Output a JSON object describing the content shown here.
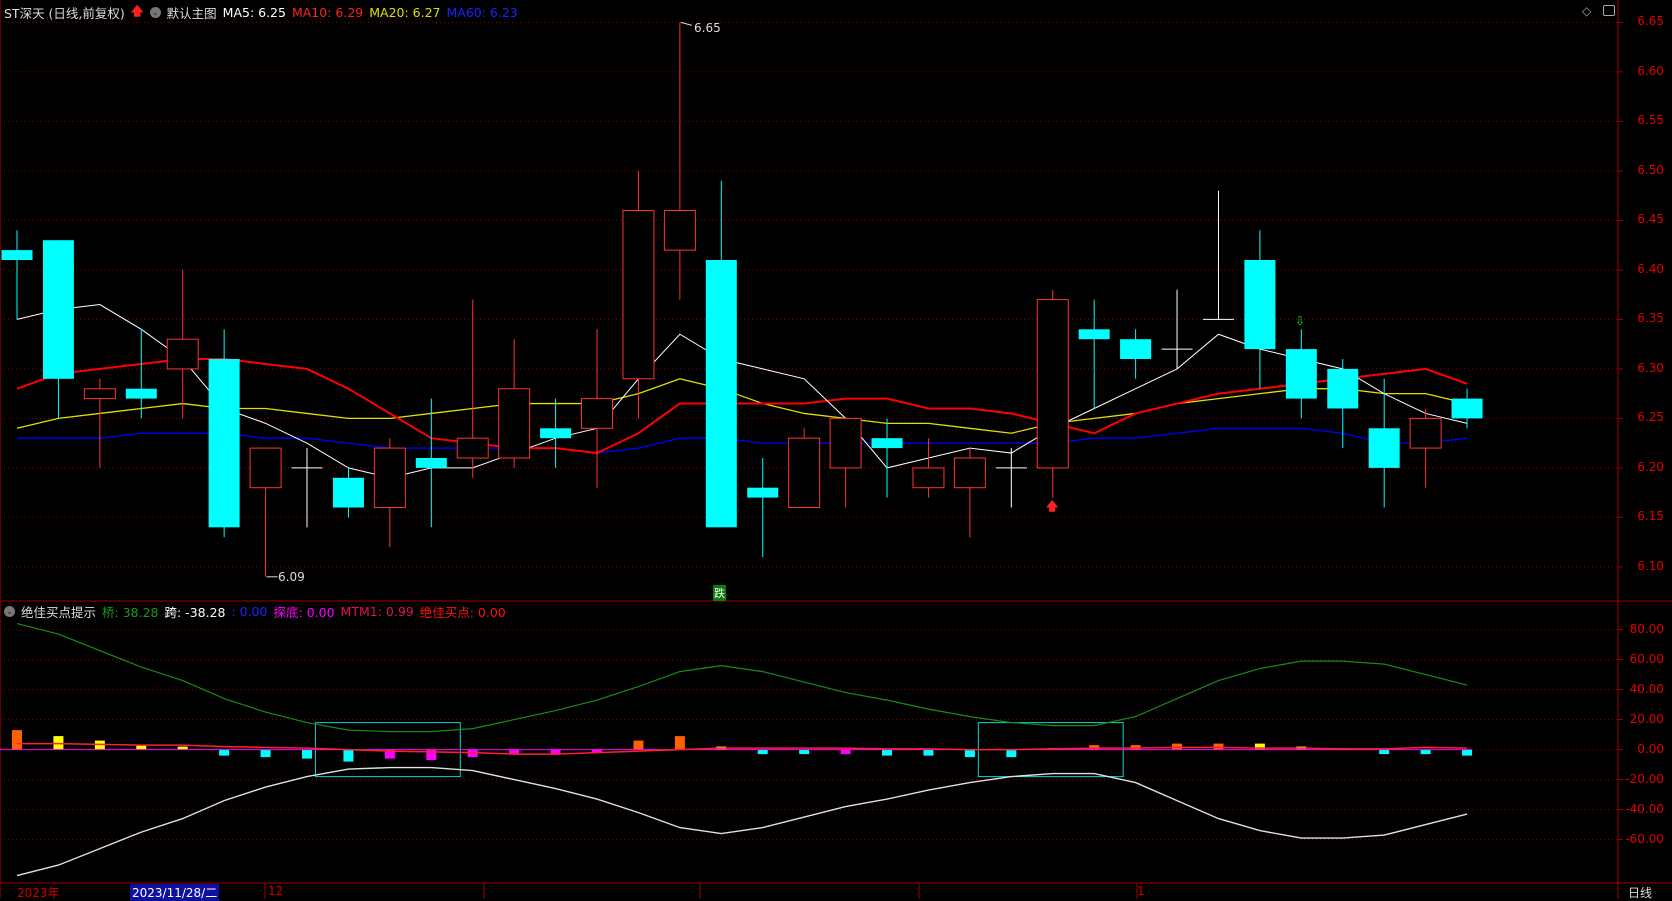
{
  "header": {
    "title": "ST深天 (日线,前复权)",
    "template": "默认主图",
    "ma5": "MA5: 6.25",
    "ma10": "MA10: 6.29",
    "ma20": "MA20: 6.27",
    "ma60": "MA60: 6.23"
  },
  "indicator_header": {
    "name": "绝佳买点提示",
    "qiao": "桥: 38.28",
    "kua": "跨: -38.28",
    "blank": ": 0.00",
    "tandi": "探底: 0.00",
    "mtm1": "MTM1: 0.99",
    "buy": "绝佳买点: 0.00"
  },
  "colors": {
    "up": "#ff3232",
    "down": "#00ffff",
    "ma5": "#ffffff",
    "ma10": "#ff0000",
    "ma20": "#e0e000",
    "ma60": "#0000ff",
    "grid": "#8b0000"
  },
  "price_axis": [
    "6.65",
    "6.60",
    "6.55",
    "6.50",
    "6.45",
    "6.40",
    "6.35",
    "6.30",
    "6.25",
    "6.20",
    "6.15",
    "6.10"
  ],
  "indicator_axis": [
    "80.00",
    "60.00",
    "40.00",
    "20.00",
    "0.00",
    "-20.00",
    "-40.00",
    "-60.00"
  ],
  "annotations": {
    "high": "6.65",
    "low": "6.09",
    "signal": "跌"
  },
  "x_axis": {
    "year": "2023年",
    "cursor_date": "2023/11/28/二",
    "dec": "12",
    "jan": "1",
    "period": "日线"
  },
  "chart_data": {
    "type": "candlestick",
    "ylim": [
      6.08,
      6.66
    ],
    "ohlc": [
      [
        6.42,
        6.44,
        6.35,
        6.41
      ],
      [
        6.43,
        6.43,
        6.25,
        6.29
      ],
      [
        6.27,
        6.29,
        6.2,
        6.28
      ],
      [
        6.28,
        6.34,
        6.25,
        6.27
      ],
      [
        6.3,
        6.4,
        6.25,
        6.33
      ],
      [
        6.31,
        6.34,
        6.13,
        6.14
      ],
      [
        6.18,
        6.22,
        6.09,
        6.22
      ],
      [
        6.2,
        6.22,
        6.14,
        6.2
      ],
      [
        6.19,
        6.2,
        6.15,
        6.16
      ],
      [
        6.16,
        6.23,
        6.12,
        6.22
      ],
      [
        6.21,
        6.27,
        6.14,
        6.2
      ],
      [
        6.21,
        6.37,
        6.19,
        6.23
      ],
      [
        6.21,
        6.33,
        6.2,
        6.28
      ],
      [
        6.24,
        6.27,
        6.2,
        6.23
      ],
      [
        6.24,
        6.34,
        6.18,
        6.27
      ],
      [
        6.29,
        6.5,
        6.25,
        6.46
      ],
      [
        6.42,
        6.65,
        6.37,
        6.46
      ],
      [
        6.41,
        6.49,
        6.14,
        6.14
      ],
      [
        6.18,
        6.21,
        6.11,
        6.17
      ],
      [
        6.16,
        6.24,
        6.16,
        6.23
      ],
      [
        6.2,
        6.25,
        6.16,
        6.25
      ],
      [
        6.23,
        6.25,
        6.17,
        6.22
      ],
      [
        6.18,
        6.23,
        6.17,
        6.2
      ],
      [
        6.18,
        6.22,
        6.13,
        6.21
      ],
      [
        6.2,
        6.22,
        6.16,
        6.2
      ],
      [
        6.2,
        6.38,
        6.17,
        6.37
      ],
      [
        6.34,
        6.37,
        6.26,
        6.33
      ],
      [
        6.33,
        6.34,
        6.29,
        6.31
      ],
      [
        6.32,
        6.38,
        6.3,
        6.32
      ],
      [
        6.35,
        6.48,
        6.35,
        6.35
      ],
      [
        6.41,
        6.44,
        6.28,
        6.32
      ],
      [
        6.32,
        6.34,
        6.25,
        6.27
      ],
      [
        6.3,
        6.31,
        6.22,
        6.26
      ],
      [
        6.24,
        6.29,
        6.16,
        6.2
      ],
      [
        6.22,
        6.26,
        6.18,
        6.25
      ],
      [
        6.27,
        6.28,
        6.24,
        6.25
      ]
    ],
    "ma5": [
      6.35,
      6.36,
      6.365,
      6.34,
      6.31,
      6.26,
      6.245,
      6.225,
      6.2,
      6.19,
      6.2,
      6.2,
      6.215,
      6.23,
      6.24,
      6.29,
      6.335,
      6.31,
      6.3,
      6.29,
      6.25,
      6.2,
      6.21,
      6.22,
      6.215,
      6.24,
      6.26,
      6.28,
      6.3,
      6.335,
      6.32,
      6.31,
      6.3,
      6.275,
      6.255,
      6.245
    ],
    "ma10": [
      6.28,
      6.295,
      6.3,
      6.305,
      6.31,
      6.31,
      6.305,
      6.3,
      6.28,
      6.255,
      6.23,
      6.225,
      6.22,
      6.22,
      6.215,
      6.235,
      6.265,
      6.265,
      6.265,
      6.265,
      6.27,
      6.27,
      6.26,
      6.26,
      6.255,
      6.245,
      6.235,
      6.255,
      6.265,
      6.275,
      6.28,
      6.285,
      6.29,
      6.295,
      6.3,
      6.285
    ],
    "ma20": [
      6.24,
      6.25,
      6.255,
      6.26,
      6.265,
      6.26,
      6.26,
      6.255,
      6.25,
      6.25,
      6.255,
      6.26,
      6.265,
      6.265,
      6.265,
      6.275,
      6.29,
      6.28,
      6.265,
      6.255,
      6.25,
      6.245,
      6.245,
      6.24,
      6.235,
      6.245,
      6.25,
      6.255,
      6.265,
      6.27,
      6.275,
      6.28,
      6.28,
      6.275,
      6.275,
      6.265
    ],
    "ma60": [
      6.23,
      6.23,
      6.23,
      6.235,
      6.235,
      6.235,
      6.23,
      6.23,
      6.225,
      6.22,
      6.22,
      6.22,
      6.22,
      6.22,
      6.215,
      6.22,
      6.23,
      6.23,
      6.225,
      6.225,
      6.225,
      6.225,
      6.225,
      6.225,
      6.225,
      6.225,
      6.23,
      6.23,
      6.235,
      6.24,
      6.24,
      6.24,
      6.235,
      6.225,
      6.225,
      6.23
    ],
    "indicator": {
      "ylim": [
        -70,
        90
      ],
      "qiao": [
        84,
        77,
        66,
        55,
        46,
        34,
        25,
        18,
        13,
        12,
        12,
        14,
        20,
        26,
        33,
        42,
        52,
        56,
        52,
        45,
        38,
        33,
        27,
        22,
        18,
        16,
        16,
        22,
        34,
        46,
        54,
        59,
        59,
        57,
        50,
        43,
        38.28
      ],
      "bars": [
        13,
        9,
        6,
        3,
        2,
        -4,
        -5,
        -6,
        -8,
        -6,
        -7,
        -5,
        -3,
        -3,
        -2,
        6,
        9,
        2,
        -3,
        -3,
        -3,
        -4,
        -4,
        -5,
        -5,
        1,
        3,
        3,
        4,
        4,
        4,
        2,
        1,
        -3,
        -3,
        -4
      ],
      "bar_colors": [
        "#ff6000",
        "#ffff00",
        "#ffff00",
        "#ffff00",
        "#ffff00",
        "#00ffff",
        "#00ffff",
        "#00ffff",
        "#00ffff",
        "#ff00ff",
        "#ff00ff",
        "#ff00ff",
        "#ff00ff",
        "#ff00ff",
        "#ff00ff",
        "#ff6000",
        "#ff6000",
        "#ffff00",
        "#00ffff",
        "#00ffff",
        "#ff00ff",
        "#00ffff",
        "#00ffff",
        "#00ffff",
        "#00ffff",
        "#ff6000",
        "#ff6000",
        "#ff6000",
        "#ff6000",
        "#ff6000",
        "#ffff00",
        "#ffff00",
        "#ff3030",
        "#00ffff",
        "#00ffff",
        "#00ffff"
      ],
      "mtm_line": [
        4,
        4,
        3.5,
        3,
        3,
        2,
        1.5,
        1,
        0,
        -1,
        -1.5,
        -2,
        -3,
        -3,
        -2,
        -1,
        0,
        1,
        1,
        1,
        1,
        0.5,
        0.5,
        0,
        0,
        0.5,
        1,
        1,
        1.5,
        1.5,
        1,
        1,
        0.5,
        0.5,
        1.5,
        0.99
      ],
      "boxes": [
        [
          8,
          10,
          18
        ],
        [
          24,
          26,
          18
        ]
      ]
    }
  }
}
